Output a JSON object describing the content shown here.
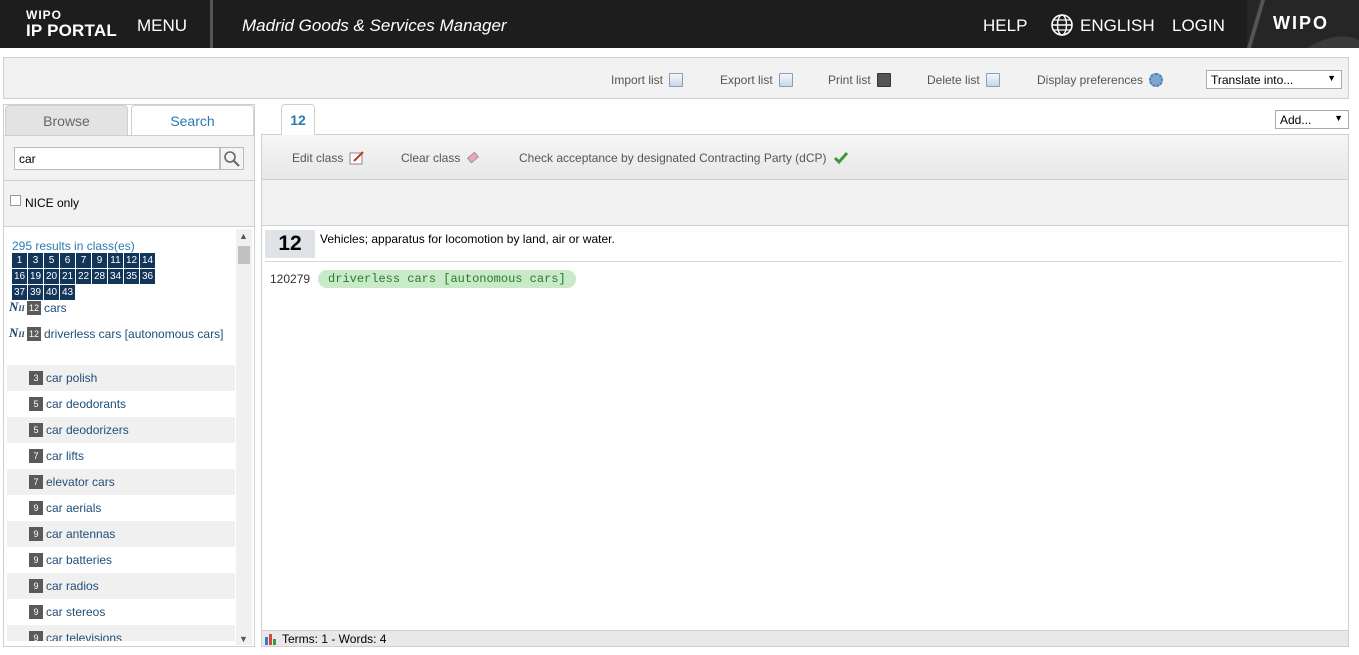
{
  "header": {
    "logo_line1": "WIPO",
    "logo_line2": "IP PORTAL",
    "menu": "MENU",
    "app_title": "Madrid Goods & Services Manager",
    "help": "HELP",
    "language": "ENGLISH",
    "login": "LOGIN",
    "brand": "WIPO"
  },
  "toolbar": {
    "import_list": "Import list",
    "export_list": "Export list",
    "print_list": "Print list",
    "delete_list": "Delete list",
    "display_preferences": "Display preferences",
    "translate_select": "Translate into..."
  },
  "left": {
    "tabs": {
      "browse": "Browse",
      "search": "Search"
    },
    "search_value": "car",
    "nice_only": "NICE only",
    "results_count": "295 results in class(es)",
    "classes": [
      "1",
      "3",
      "5",
      "6",
      "7",
      "9",
      "11",
      "12",
      "14",
      "16",
      "19",
      "20",
      "21",
      "22",
      "28",
      "34",
      "35",
      "36",
      "37",
      "39",
      "40",
      "43"
    ],
    "items": [
      {
        "nice": "N",
        "class": "12",
        "label": "cars"
      },
      {
        "nice": "N",
        "class": "12",
        "label": "driverless cars [autonomous cars]"
      },
      {
        "nice": "",
        "class": "3",
        "label": "car polish"
      },
      {
        "nice": "",
        "class": "5",
        "label": "car deodorants"
      },
      {
        "nice": "",
        "class": "5",
        "label": "car deodorizers"
      },
      {
        "nice": "",
        "class": "7",
        "label": "car lifts"
      },
      {
        "nice": "",
        "class": "7",
        "label": "elevator cars"
      },
      {
        "nice": "",
        "class": "9",
        "label": "car aerials"
      },
      {
        "nice": "",
        "class": "9",
        "label": "car antennas"
      },
      {
        "nice": "",
        "class": "9",
        "label": "car batteries"
      },
      {
        "nice": "",
        "class": "9",
        "label": "car radios"
      },
      {
        "nice": "",
        "class": "9",
        "label": "car stereos"
      },
      {
        "nice": "",
        "class": "9",
        "label": "car televisions"
      }
    ]
  },
  "right": {
    "class_tab": "12",
    "add_select": "Add...",
    "actions": {
      "edit_class": "Edit class",
      "clear_class": "Clear class",
      "check_acceptance": "Check acceptance by designated Contracting Party (dCP)"
    },
    "class_number": "12",
    "class_description": "Vehicles; apparatus for locomotion by land, air or water.",
    "terms": [
      {
        "id": "120279",
        "label": "driverless cars [autonomous cars]"
      }
    ],
    "status": "Terms: 1 - Words: 4"
  },
  "colors": {
    "header_bg": "#1d1d1d",
    "link_blue": "#2a7ab0",
    "class_box": "#12355a",
    "term_chip_bg": "#c8eac8",
    "term_chip_fg": "#2b7a2b"
  }
}
